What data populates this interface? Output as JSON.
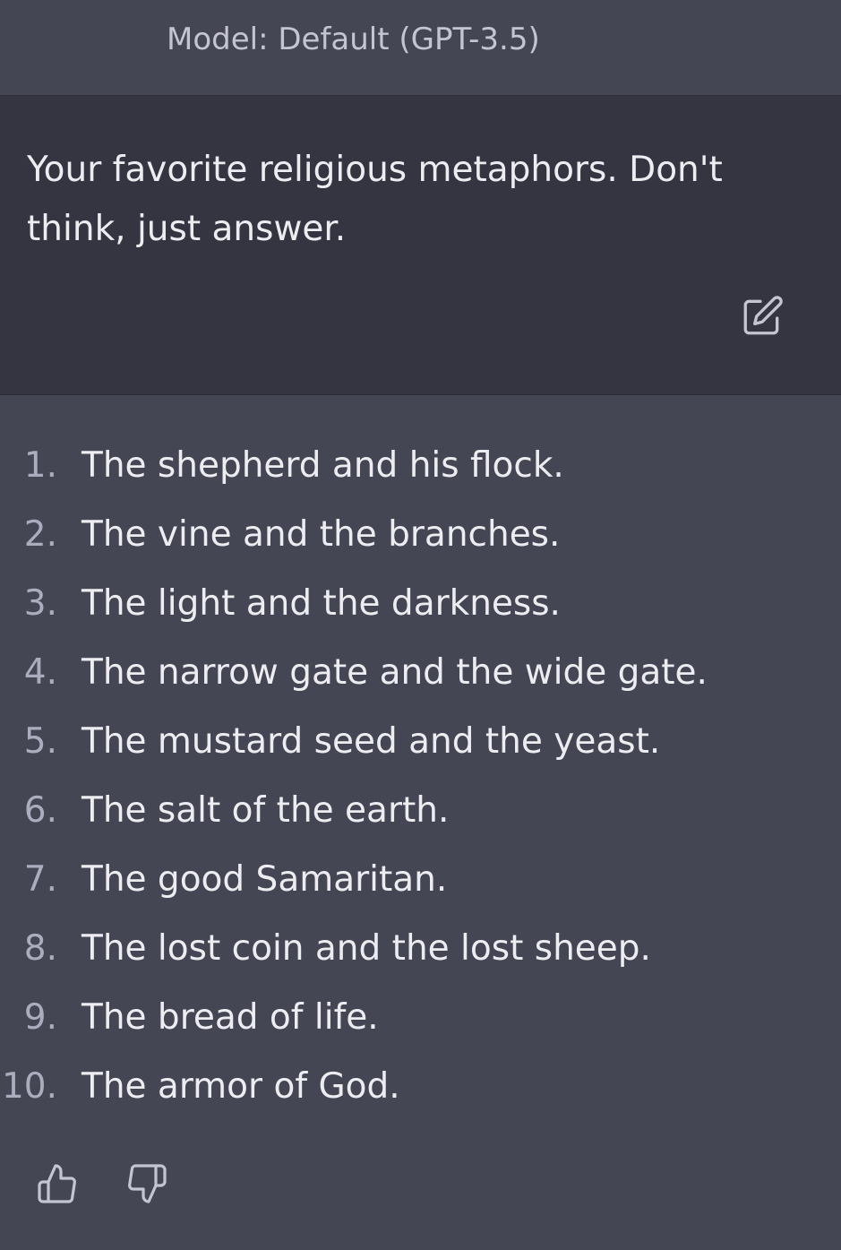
{
  "header": {
    "model_label": "Model: Default (GPT-3.5)"
  },
  "user_message": {
    "text": "Your favorite religious metaphors. Don't think, just answer.",
    "edit_icon": "edit-icon"
  },
  "assistant_message": {
    "items": [
      {
        "number": "1.",
        "text": "The shepherd and his flock."
      },
      {
        "number": "2.",
        "text": "The vine and the branches."
      },
      {
        "number": "3.",
        "text": "The light and the darkness."
      },
      {
        "number": "4.",
        "text": "The narrow gate and the wide gate."
      },
      {
        "number": "5.",
        "text": "The mustard seed and the yeast."
      },
      {
        "number": "6.",
        "text": "The salt of the earth."
      },
      {
        "number": "7.",
        "text": "The good Samaritan."
      },
      {
        "number": "8.",
        "text": "The lost coin and the lost sheep."
      },
      {
        "number": "9.",
        "text": "The bread of life."
      },
      {
        "number": "10.",
        "text": "The armor of God."
      }
    ],
    "feedback": {
      "thumbs_up_icon": "thumbs-up-icon",
      "thumbs_down_icon": "thumbs-down-icon"
    }
  },
  "colors": {
    "assistant_bg": "#444654",
    "user_bg": "#343541",
    "text": "#ececf1",
    "muted": "#c5c5d2"
  }
}
